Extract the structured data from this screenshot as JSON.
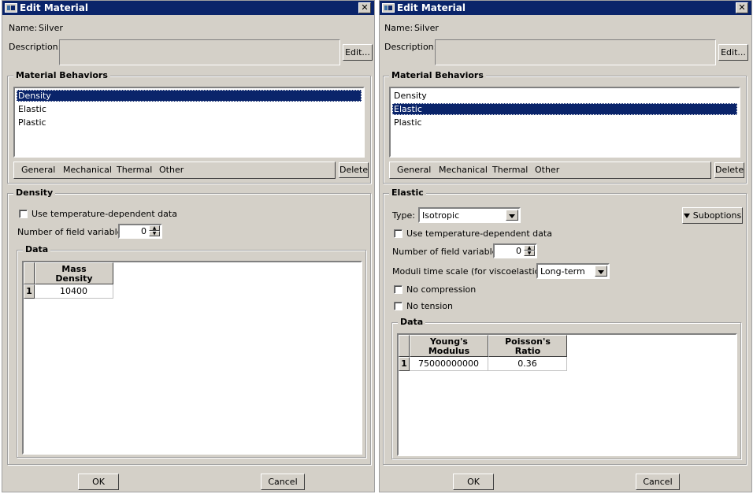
{
  "dialogs": [
    {
      "title": "Edit Material",
      "name_label": "Name:",
      "name_value": "Silver",
      "description_label": "Description:",
      "description_value": "",
      "edit_button": "Edit...",
      "behaviors_group": "Material Behaviors",
      "behaviors": [
        {
          "label": "Density",
          "selected": true
        },
        {
          "label": "Elastic",
          "selected": false
        },
        {
          "label": "Plastic",
          "selected": false
        }
      ],
      "menu": [
        "General",
        "Mechanical",
        "Thermal",
        "Other"
      ],
      "delete_button": "Delete",
      "section_title": "Density",
      "temp_dependent_label": "Use temperature-dependent data",
      "field_vars_label": "Number of field variables:",
      "field_vars_value": "0",
      "data_group": "Data",
      "table": {
        "columns": [
          "Mass\nDensity"
        ],
        "rows": [
          {
            "index": "1",
            "cells": [
              "10400"
            ]
          }
        ]
      },
      "ok_button": "OK",
      "cancel_button": "Cancel"
    },
    {
      "title": "Edit Material",
      "name_label": "Name:",
      "name_value": "Silver",
      "description_label": "Description:",
      "description_value": "",
      "edit_button": "Edit...",
      "behaviors_group": "Material Behaviors",
      "behaviors": [
        {
          "label": "Density",
          "selected": false
        },
        {
          "label": "Elastic",
          "selected": true
        },
        {
          "label": "Plastic",
          "selected": false
        }
      ],
      "menu": [
        "General",
        "Mechanical",
        "Thermal",
        "Other"
      ],
      "delete_button": "Delete",
      "section_title": "Elastic",
      "type_label": "Type:",
      "type_value": "Isotropic",
      "suboptions_button": "Suboptions",
      "temp_dependent_label": "Use temperature-dependent data",
      "field_vars_label": "Number of field variables:",
      "field_vars_value": "0",
      "moduli_label": "Moduli time scale (for viscoelasticity):",
      "moduli_value": "Long-term",
      "no_compression_label": "No compression",
      "no_tension_label": "No tension",
      "data_group": "Data",
      "table": {
        "columns": [
          "Young's\nModulus",
          "Poisson's\nRatio"
        ],
        "rows": [
          {
            "index": "1",
            "cells": [
              "75000000000",
              "0.36"
            ]
          }
        ]
      },
      "ok_button": "OK",
      "cancel_button": "Cancel"
    }
  ]
}
